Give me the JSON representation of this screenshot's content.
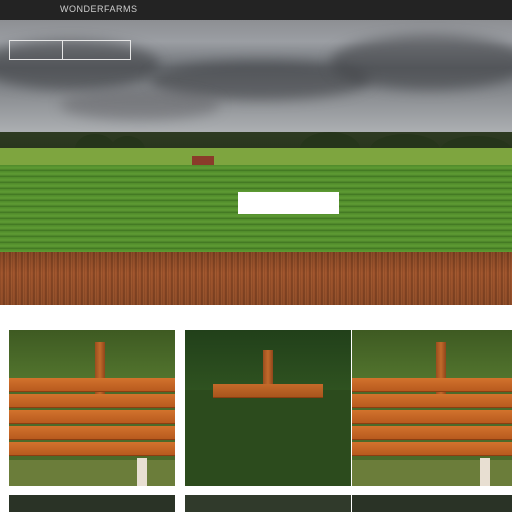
{
  "topbar": {
    "brand": "WONDERFARMS",
    "center_text": "",
    "links": [
      "",
      "",
      ""
    ]
  },
  "hero": {
    "logo_left": "",
    "logo_right": "",
    "nav": [
      "",
      "",
      "",
      "",
      "",
      ""
    ],
    "title": "",
    "button": ""
  },
  "cards": [
    {
      "title": "",
      "desc": [
        "",
        "",
        "",
        ""
      ]
    },
    {
      "title": "",
      "desc": [
        "",
        "",
        "",
        ""
      ]
    },
    {
      "title": "",
      "desc": [
        "",
        "",
        "",
        ""
      ]
    }
  ],
  "colors": {
    "topbar": "#232323",
    "field": "#5f9c34",
    "soil": "#a85a30",
    "plank": "#d2732d"
  }
}
